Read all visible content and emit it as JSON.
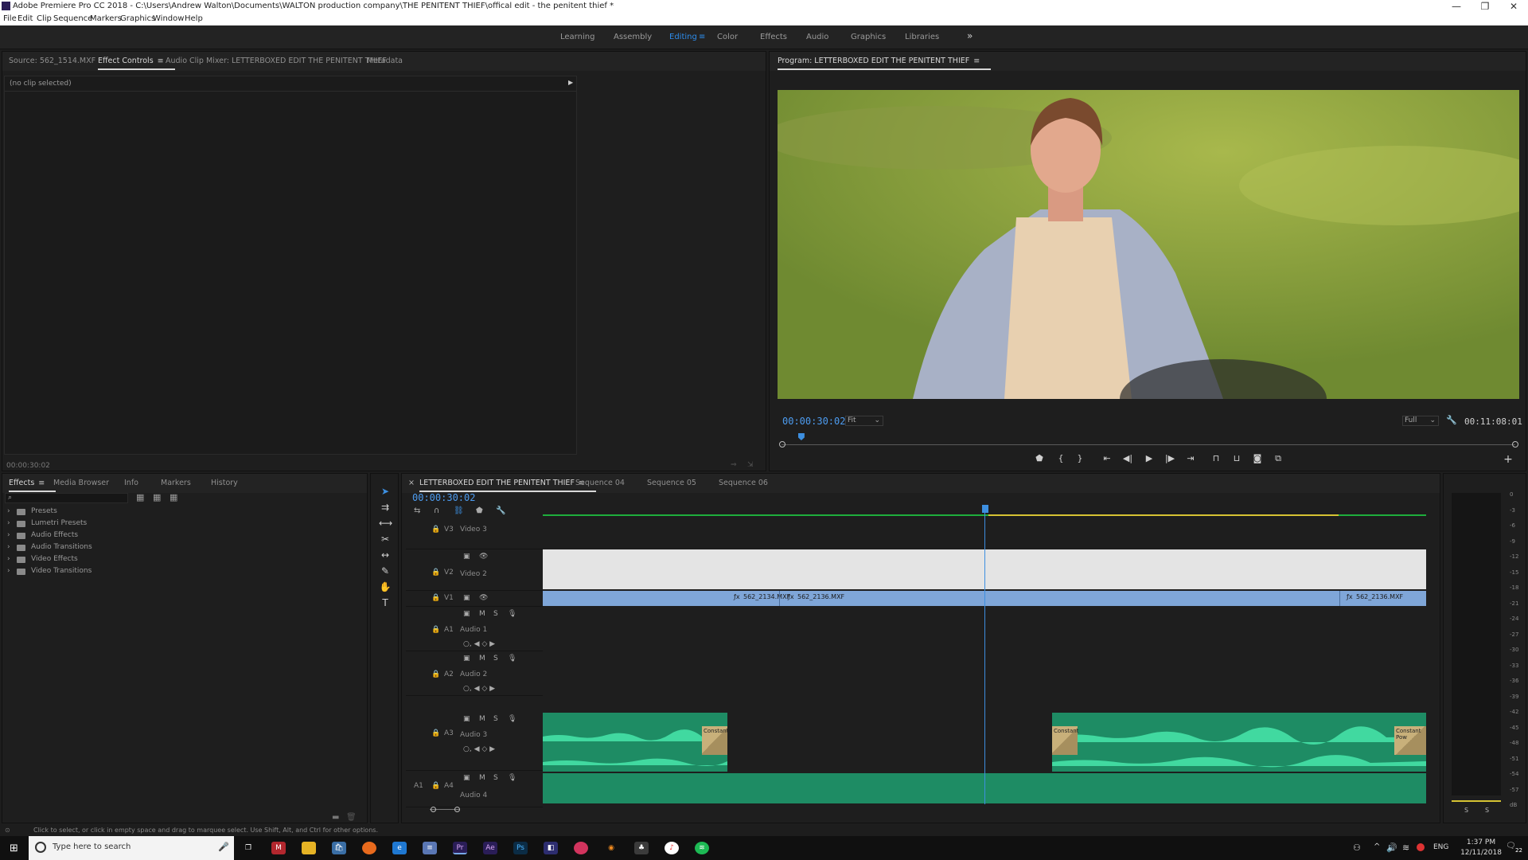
{
  "window": {
    "title": "Adobe Premiere Pro CC 2018 - C:\\Users\\Andrew Walton\\Documents\\WALTON production company\\THE PENITENT THIEF\\offical edit - the penitent thief *",
    "minimize": "—",
    "restore": "❐",
    "close": "✕"
  },
  "menu": [
    "File",
    "Edit",
    "Clip",
    "Sequence",
    "Markers",
    "Graphics",
    "Window",
    "Help"
  ],
  "workspaces": {
    "items": [
      "Learning",
      "Assembly",
      "Editing",
      "Color",
      "Effects",
      "Audio",
      "Graphics",
      "Libraries"
    ],
    "more": "»"
  },
  "effect_controls": {
    "tabs": [
      "Source: 562_1514.MXF",
      "Effect Controls",
      "Audio Clip Mixer: LETTERBOXED EDIT THE PENITENT THIEF",
      "Metadata"
    ],
    "no_clip": "(no clip selected)",
    "footer_tc": "00:00:30:02"
  },
  "program": {
    "tab": "Program: LETTERBOXED EDIT THE PENITENT THIEF",
    "current_tc": "00:00:30:02",
    "fit": "Fit",
    "quality": "Full",
    "duration_tc": "00:11:08:01",
    "playhead_fraction": 0.027,
    "controls": [
      "marker-icon",
      "mark-in-icon",
      "mark-out-icon",
      "go-to-in-icon",
      "step-back-icon",
      "play-icon",
      "step-forward-icon",
      "go-to-out-icon",
      "lift-icon",
      "extract-icon",
      "export-frame-icon",
      "compare-icon"
    ],
    "colors": {
      "timecode": "#4d9cf0"
    }
  },
  "project": {
    "tabs": [
      "Effects",
      "Media Browser",
      "Info",
      "Markers",
      "History"
    ],
    "search_placeholder": "",
    "tree": [
      "Presets",
      "Lumetri Presets",
      "Audio Effects",
      "Audio Transitions",
      "Video Effects",
      "Video Transitions"
    ]
  },
  "timeline": {
    "tabs": [
      "LETTERBOXED EDIT THE PENITENT THIEF",
      "Sequence 04",
      "Sequence 05",
      "Sequence 06"
    ],
    "timecode": "00:00:30:02",
    "playhead_fraction": 0.5,
    "tracks": {
      "v3": {
        "id": "V3",
        "name": "Video 3"
      },
      "v2": {
        "id": "V2",
        "name": "Video 2"
      },
      "v1": {
        "id": "V1",
        "name": ""
      },
      "a1": {
        "id": "A1",
        "name": "Audio 1"
      },
      "a2": {
        "id": "A2",
        "name": "Audio 2"
      },
      "a3": {
        "id": "A3",
        "name": "Audio 3"
      },
      "a4": {
        "id": "A4",
        "name": "Audio 4"
      }
    },
    "clips": {
      "v1_a": "562_2134.MXF",
      "v1_b": "562_2136.MXF",
      "v1_c": "562_2136.MXF"
    },
    "transitions": {
      "a3_left": "Constant",
      "a3_mid": "Constant",
      "a3_right": "Constant Pow"
    },
    "meter_scale": [
      "0",
      "-3",
      "-6",
      "-9",
      "-12",
      "-15",
      "-18",
      "-21",
      "-24",
      "-27",
      "-30",
      "-33",
      "-36",
      "-39",
      "-42",
      "-45",
      "-48",
      "-51",
      "-54",
      "-57",
      "dB"
    ],
    "meter_solo": [
      "S",
      "S"
    ],
    "colors": {
      "video_clip": "#7fa6d8",
      "audio_clip": "#1e8c64",
      "v2_clip": "#e4e4e4"
    }
  },
  "status_bar": {
    "hint": "Click to select, or click in empty space and drag to marquee select. Use Shift, Alt, and Ctrl for other options."
  },
  "taskbar": {
    "search_placeholder": "Type here to search",
    "lang": "ENG",
    "time": "1:37 PM",
    "date": "12/11/2018",
    "notif": "22",
    "apps": [
      "Pr",
      "Ae",
      "Ps"
    ]
  }
}
